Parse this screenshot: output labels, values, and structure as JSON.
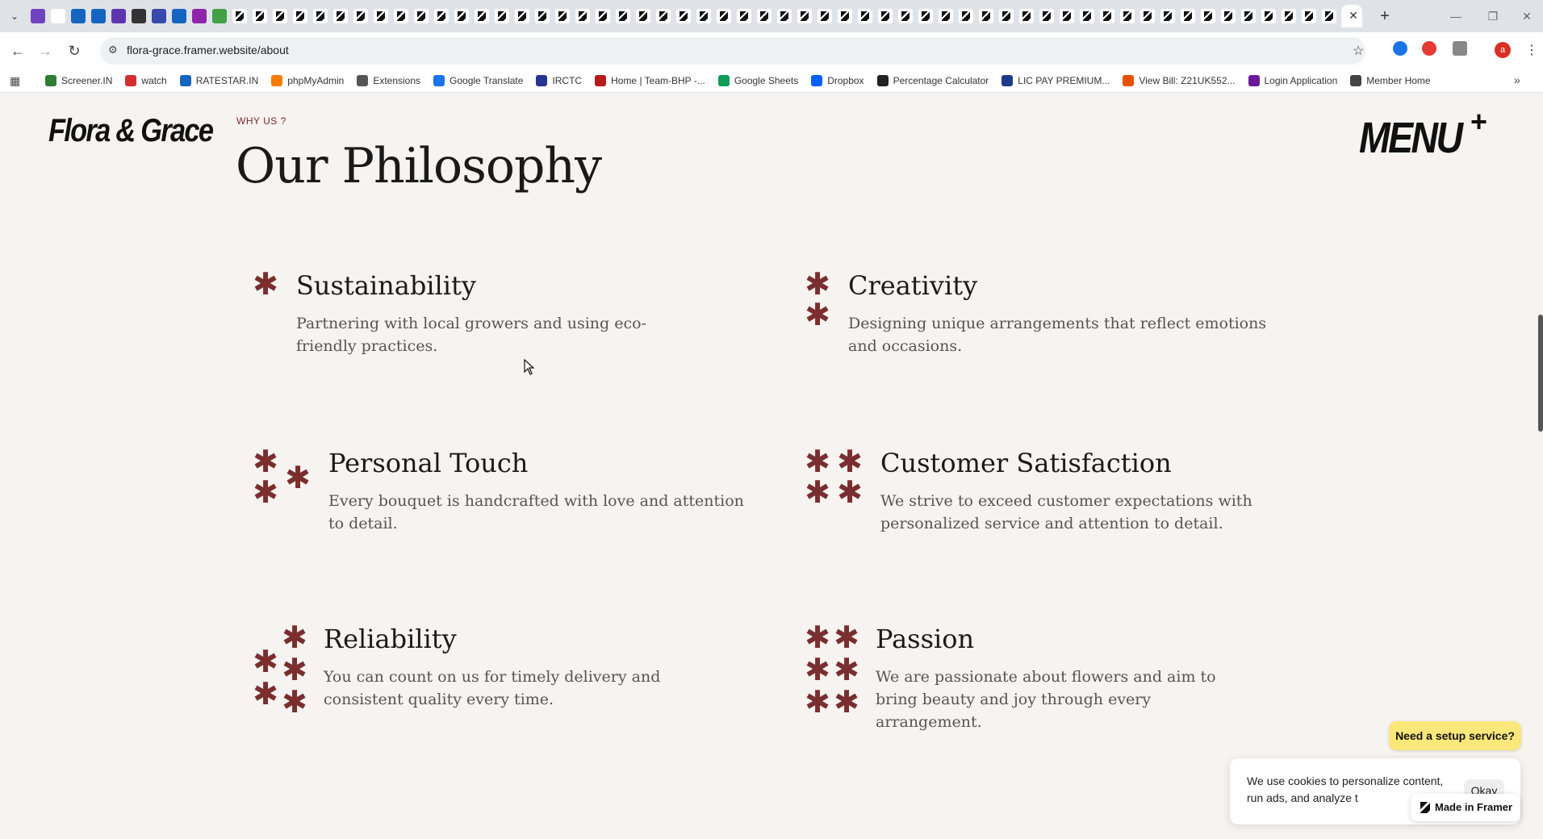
{
  "browser": {
    "url": "flora-grace.framer.website/about",
    "avatar_letter": "a",
    "bookmarks": [
      {
        "label": "Screener.IN",
        "color": "#2e7d32"
      },
      {
        "label": "watch",
        "color": "#d32f2f"
      },
      {
        "label": "RATESTAR.IN",
        "color": "#1565c0"
      },
      {
        "label": "phpMyAdmin",
        "color": "#f57c00"
      },
      {
        "label": "Extensions",
        "color": "#555555"
      },
      {
        "label": "Google Translate",
        "color": "#1a73e8"
      },
      {
        "label": "IRCTC",
        "color": "#283593"
      },
      {
        "label": "Home | Team-BHP -...",
        "color": "#b71c1c"
      },
      {
        "label": "Google Sheets",
        "color": "#0f9d58"
      },
      {
        "label": "Dropbox",
        "color": "#0061fe"
      },
      {
        "label": "Percentage Calculator",
        "color": "#222222"
      },
      {
        "label": "LIC PAY PREMIUM...",
        "color": "#1e3a8a"
      },
      {
        "label": "View Bill: Z21UK552...",
        "color": "#e65100"
      },
      {
        "label": "Login Application",
        "color": "#6a1b9a"
      },
      {
        "label": "Member Home",
        "color": "#444444"
      }
    ]
  },
  "site": {
    "logo": "Flora & Grace",
    "menu_label": "MENU",
    "menu_plus": "+",
    "eyebrow": "WHY US ?",
    "title": "Our Philosophy"
  },
  "cards": [
    {
      "title": "Sustainability",
      "text": "Partnering with local growers and using eco-friendly practices.",
      "stars": 1
    },
    {
      "title": "Creativity",
      "text": "Designing unique arrangements that reflect emotions and occasions.",
      "stars": 2
    },
    {
      "title": "Personal Touch",
      "text": "Every bouquet is handcrafted with love and attention to detail.",
      "stars": 3
    },
    {
      "title": "Customer Satisfaction",
      "text": "We strive to exceed customer expectations with personalized service and attention to detail.",
      "stars": 4
    },
    {
      "title": "Reliability",
      "text": "You can count on us for timely delivery and consistent quality every time.",
      "stars": 5
    },
    {
      "title": "Passion",
      "text": "We are passionate about flowers and aim to bring beauty and joy through every arrangement.",
      "stars": 6
    }
  ],
  "overlays": {
    "setup_button": "Need a setup service?",
    "cookie_text": "We use cookies to personalize content, run ads, and analyze t",
    "cookie_okay": "Okay",
    "framer_badge": "Made in Framer"
  },
  "colors": {
    "accent": "#7a2e2e",
    "background": "#f6f3f0",
    "setup_button_bg": "#fbe77a"
  }
}
